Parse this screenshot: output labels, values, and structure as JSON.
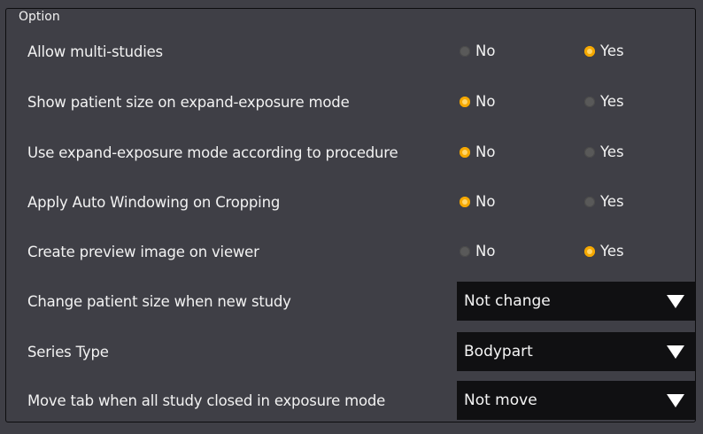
{
  "group": {
    "title": "Option"
  },
  "rows": [
    {
      "label": "Allow multi-studies",
      "no": "No",
      "yes": "Yes",
      "selected": "yes"
    },
    {
      "label": "Show patient size on expand-exposure mode",
      "no": "No",
      "yes": "Yes",
      "selected": "no"
    },
    {
      "label": "Use expand-exposure mode according to procedure",
      "no": "No",
      "yes": "Yes",
      "selected": "no"
    },
    {
      "label": "Apply Auto Windowing on Cropping",
      "no": "No",
      "yes": "Yes",
      "selected": "no"
    },
    {
      "label": "Create preview image on viewer",
      "no": "No",
      "yes": "Yes",
      "selected": "yes"
    }
  ],
  "dropdowns": [
    {
      "label": "Change patient size when new study",
      "value": "Not change"
    },
    {
      "label": "Series Type",
      "value": "Bodypart"
    },
    {
      "label": "Move tab when all study closed in exposure mode",
      "value": "Not move"
    }
  ],
  "colors": {
    "background": "#3f3f46",
    "accent": "#f5a800",
    "select_bg": "#101012"
  }
}
